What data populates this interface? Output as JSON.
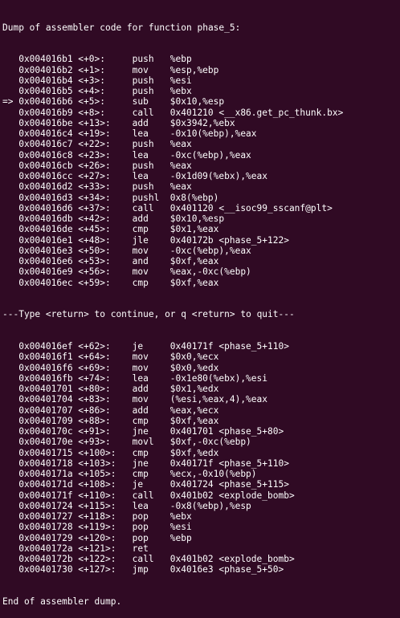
{
  "header": "Dump of assembler code for function phase_5:",
  "block1": [
    {
      "marker": "",
      "addr": "0x004016b1",
      "off": "<+0>:",
      "mnem": "push",
      "ops": "%ebp"
    },
    {
      "marker": "",
      "addr": "0x004016b2",
      "off": "<+1>:",
      "mnem": "mov",
      "ops": "%esp,%ebp"
    },
    {
      "marker": "",
      "addr": "0x004016b4",
      "off": "<+3>:",
      "mnem": "push",
      "ops": "%esi"
    },
    {
      "marker": "",
      "addr": "0x004016b5",
      "off": "<+4>:",
      "mnem": "push",
      "ops": "%ebx"
    },
    {
      "marker": "=>",
      "addr": "0x004016b6",
      "off": "<+5>:",
      "mnem": "sub",
      "ops": "$0x10,%esp"
    },
    {
      "marker": "",
      "addr": "0x004016b9",
      "off": "<+8>:",
      "mnem": "call",
      "ops": "0x401210 <__x86.get_pc_thunk.bx>"
    },
    {
      "marker": "",
      "addr": "0x004016be",
      "off": "<+13>:",
      "mnem": "add",
      "ops": "$0x3942,%ebx"
    },
    {
      "marker": "",
      "addr": "0x004016c4",
      "off": "<+19>:",
      "mnem": "lea",
      "ops": "-0x10(%ebp),%eax"
    },
    {
      "marker": "",
      "addr": "0x004016c7",
      "off": "<+22>:",
      "mnem": "push",
      "ops": "%eax"
    },
    {
      "marker": "",
      "addr": "0x004016c8",
      "off": "<+23>:",
      "mnem": "lea",
      "ops": "-0xc(%ebp),%eax"
    },
    {
      "marker": "",
      "addr": "0x004016cb",
      "off": "<+26>:",
      "mnem": "push",
      "ops": "%eax"
    },
    {
      "marker": "",
      "addr": "0x004016cc",
      "off": "<+27>:",
      "mnem": "lea",
      "ops": "-0x1d09(%ebx),%eax"
    },
    {
      "marker": "",
      "addr": "0x004016d2",
      "off": "<+33>:",
      "mnem": "push",
      "ops": "%eax"
    },
    {
      "marker": "",
      "addr": "0x004016d3",
      "off": "<+34>:",
      "mnem": "pushl",
      "ops": "0x8(%ebp)"
    },
    {
      "marker": "",
      "addr": "0x004016d6",
      "off": "<+37>:",
      "mnem": "call",
      "ops": "0x401120 <__isoc99_sscanf@plt>"
    },
    {
      "marker": "",
      "addr": "0x004016db",
      "off": "<+42>:",
      "mnem": "add",
      "ops": "$0x10,%esp"
    },
    {
      "marker": "",
      "addr": "0x004016de",
      "off": "<+45>:",
      "mnem": "cmp",
      "ops": "$0x1,%eax"
    },
    {
      "marker": "",
      "addr": "0x004016e1",
      "off": "<+48>:",
      "mnem": "jle",
      "ops": "0x40172b <phase_5+122>"
    },
    {
      "marker": "",
      "addr": "0x004016e3",
      "off": "<+50>:",
      "mnem": "mov",
      "ops": "-0xc(%ebp),%eax"
    },
    {
      "marker": "",
      "addr": "0x004016e6",
      "off": "<+53>:",
      "mnem": "and",
      "ops": "$0xf,%eax"
    },
    {
      "marker": "",
      "addr": "0x004016e9",
      "off": "<+56>:",
      "mnem": "mov",
      "ops": "%eax,-0xc(%ebp)"
    },
    {
      "marker": "",
      "addr": "0x004016ec",
      "off": "<+59>:",
      "mnem": "cmp",
      "ops": "$0xf,%eax"
    }
  ],
  "pager_prompt": "---Type <return> to continue, or q <return> to quit---",
  "block2": [
    {
      "marker": "",
      "addr": "0x004016ef",
      "off": "<+62>:",
      "mnem": "je",
      "ops": "0x40171f <phase_5+110>"
    },
    {
      "marker": "",
      "addr": "0x004016f1",
      "off": "<+64>:",
      "mnem": "mov",
      "ops": "$0x0,%ecx"
    },
    {
      "marker": "",
      "addr": "0x004016f6",
      "off": "<+69>:",
      "mnem": "mov",
      "ops": "$0x0,%edx"
    },
    {
      "marker": "",
      "addr": "0x004016fb",
      "off": "<+74>:",
      "mnem": "lea",
      "ops": "-0x1e80(%ebx),%esi"
    },
    {
      "marker": "",
      "addr": "0x00401701",
      "off": "<+80>:",
      "mnem": "add",
      "ops": "$0x1,%edx"
    },
    {
      "marker": "",
      "addr": "0x00401704",
      "off": "<+83>:",
      "mnem": "mov",
      "ops": "(%esi,%eax,4),%eax"
    },
    {
      "marker": "",
      "addr": "0x00401707",
      "off": "<+86>:",
      "mnem": "add",
      "ops": "%eax,%ecx"
    },
    {
      "marker": "",
      "addr": "0x00401709",
      "off": "<+88>:",
      "mnem": "cmp",
      "ops": "$0xf,%eax"
    },
    {
      "marker": "",
      "addr": "0x0040170c",
      "off": "<+91>:",
      "mnem": "jne",
      "ops": "0x401701 <phase_5+80>"
    },
    {
      "marker": "",
      "addr": "0x0040170e",
      "off": "<+93>:",
      "mnem": "movl",
      "ops": "$0xf,-0xc(%ebp)"
    },
    {
      "marker": "",
      "addr": "0x00401715",
      "off": "<+100>:",
      "mnem": "cmp",
      "ops": "$0xf,%edx"
    },
    {
      "marker": "",
      "addr": "0x00401718",
      "off": "<+103>:",
      "mnem": "jne",
      "ops": "0x40171f <phase_5+110>"
    },
    {
      "marker": "",
      "addr": "0x0040171a",
      "off": "<+105>:",
      "mnem": "cmp",
      "ops": "%ecx,-0x10(%ebp)"
    },
    {
      "marker": "",
      "addr": "0x0040171d",
      "off": "<+108>:",
      "mnem": "je",
      "ops": "0x401724 <phase_5+115>"
    },
    {
      "marker": "",
      "addr": "0x0040171f",
      "off": "<+110>:",
      "mnem": "call",
      "ops": "0x401b02 <explode_bomb>"
    },
    {
      "marker": "",
      "addr": "0x00401724",
      "off": "<+115>:",
      "mnem": "lea",
      "ops": "-0x8(%ebp),%esp"
    },
    {
      "marker": "",
      "addr": "0x00401727",
      "off": "<+118>:",
      "mnem": "pop",
      "ops": "%ebx"
    },
    {
      "marker": "",
      "addr": "0x00401728",
      "off": "<+119>:",
      "mnem": "pop",
      "ops": "%esi"
    },
    {
      "marker": "",
      "addr": "0x00401729",
      "off": "<+120>:",
      "mnem": "pop",
      "ops": "%ebp"
    },
    {
      "marker": "",
      "addr": "0x0040172a",
      "off": "<+121>:",
      "mnem": "ret",
      "ops": ""
    },
    {
      "marker": "",
      "addr": "0x0040172b",
      "off": "<+122>:",
      "mnem": "call",
      "ops": "0x401b02 <explode_bomb>"
    },
    {
      "marker": "",
      "addr": "0x00401730",
      "off": "<+127>:",
      "mnem": "jmp",
      "ops": "0x4016e3 <phase_5+50>"
    }
  ],
  "footer": "End of assembler dump.",
  "colors": {
    "background": "#300a24",
    "text": "#ffffff"
  }
}
